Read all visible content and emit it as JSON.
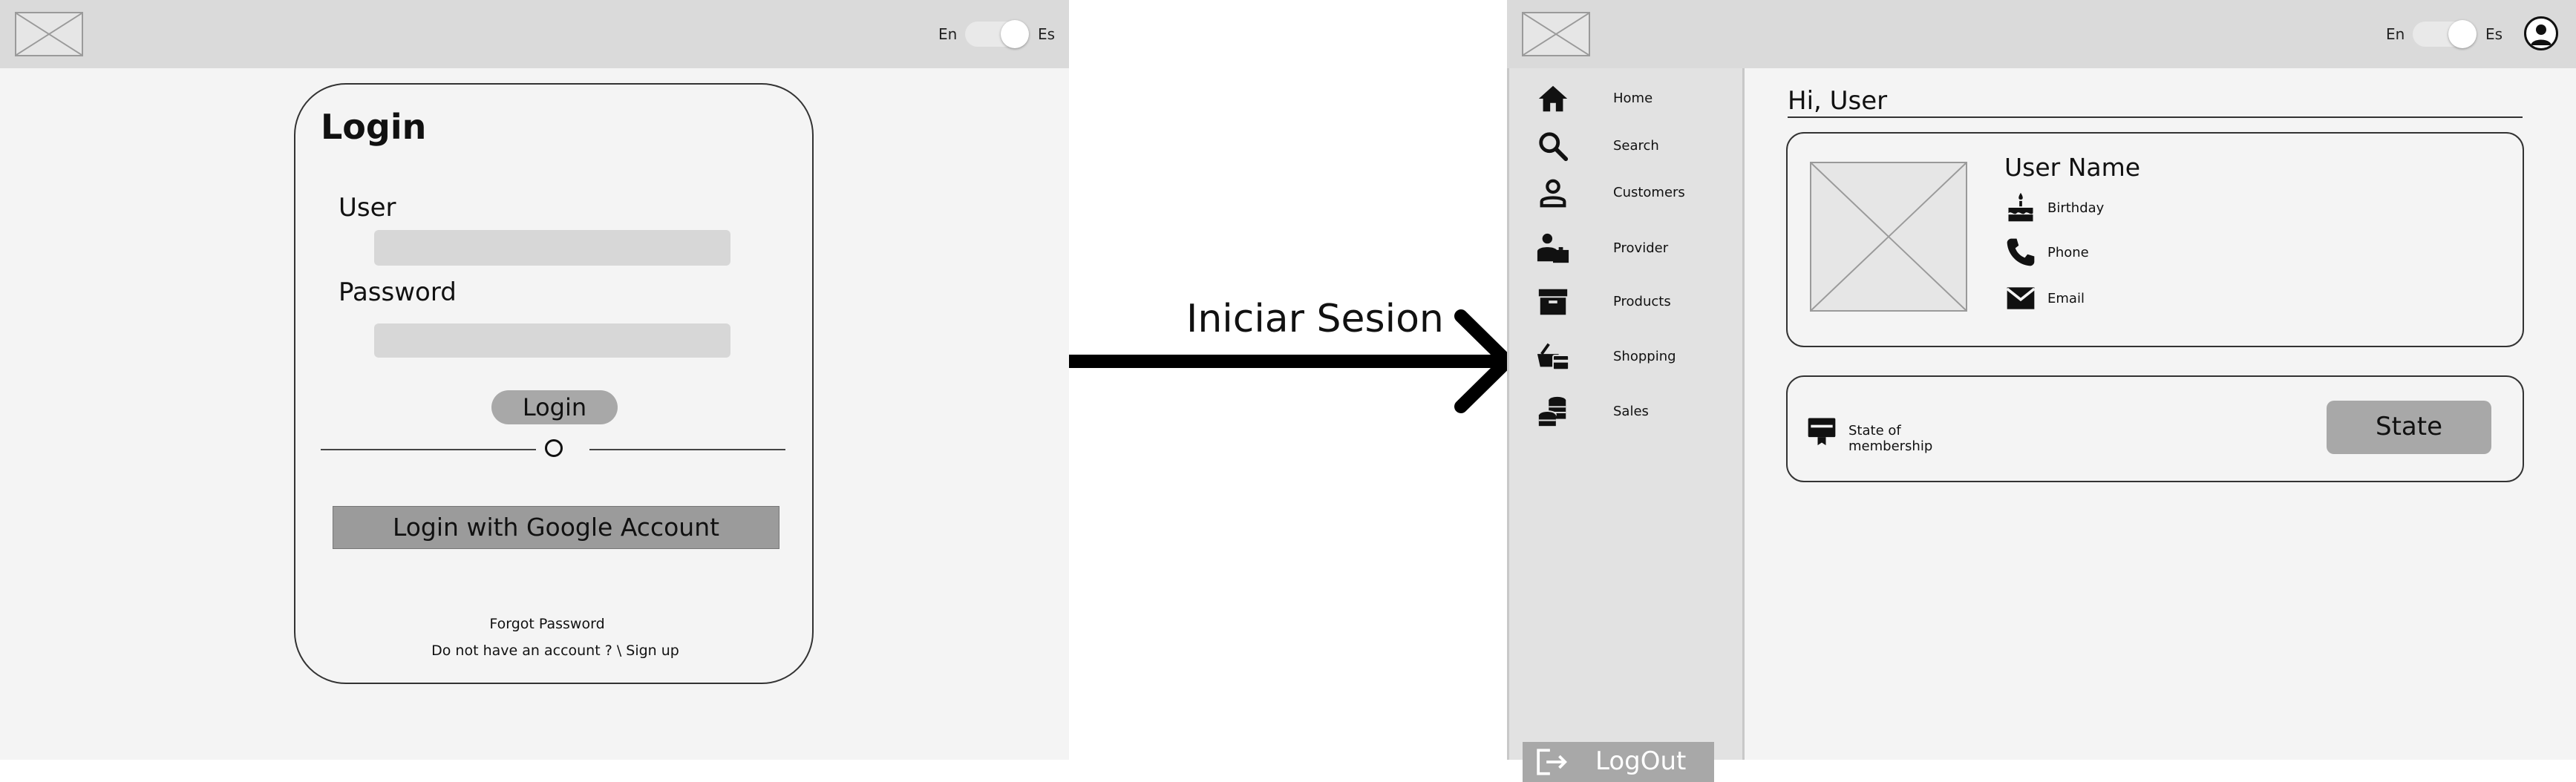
{
  "header": {
    "lang_en": "En",
    "lang_es": "Es",
    "logo_icon": "image-placeholder-icon",
    "avatar_icon": "user-avatar-icon"
  },
  "login": {
    "title": "Login",
    "user_label": "User",
    "user_value": "",
    "password_label": "Password",
    "password_value": "",
    "login_button": "Login",
    "divider_symbol": "O",
    "google_button": "Login with Google Account",
    "forgot_password": "Forgot Password",
    "signup_text": "Do not have an account ? \\ Sign up"
  },
  "transition": {
    "label": "Iniciar Sesion"
  },
  "sidebar": {
    "items": [
      {
        "label": "Home",
        "icon": "home-icon"
      },
      {
        "label": "Search",
        "icon": "search-icon"
      },
      {
        "label": "Customers",
        "icon": "person-icon"
      },
      {
        "label": "Provider",
        "icon": "provider-icon"
      },
      {
        "label": "Products",
        "icon": "archive-box-icon"
      },
      {
        "label": "Shopping",
        "icon": "shopping-basket-icon"
      },
      {
        "label": "Sales",
        "icon": "coins-icon"
      }
    ],
    "logout_label": "LogOut"
  },
  "dashboard": {
    "greeting": "Hi, User",
    "profile": {
      "name": "User Name",
      "birthday_label": "Birthday",
      "phone_label": "Phone",
      "email_label": "Email"
    },
    "membership": {
      "label": "State of membership",
      "state_button": "State"
    }
  },
  "colors": {
    "panel_bg": "#f4f4f4",
    "topbar_bg": "#dadada",
    "sidebar_bg": "#e2e2e2",
    "button_gray": "#a8a8a8",
    "google_button_gray": "#9b9b9b"
  }
}
